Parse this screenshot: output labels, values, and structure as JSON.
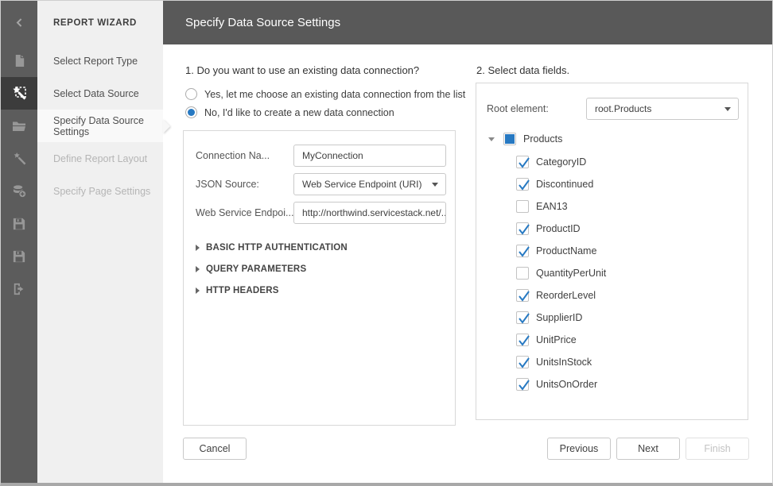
{
  "colors": {
    "accent_blue": "#2779c2",
    "header_bg": "#595959",
    "iconbar_bg": "#5c5c5c",
    "iconbar_active_bg": "#3c3c3c",
    "sidebar_bg": "#f0f0f0"
  },
  "iconbar": {
    "items": [
      {
        "icon": "back-chevron",
        "back": true
      },
      {
        "icon": "new-document"
      },
      {
        "icon": "report-wizard",
        "active": true
      },
      {
        "icon": "open-folder"
      },
      {
        "icon": "design-wizard"
      },
      {
        "icon": "add-datasource"
      },
      {
        "icon": "save"
      },
      {
        "icon": "save-as"
      },
      {
        "icon": "exit"
      }
    ]
  },
  "sidebar": {
    "title": "REPORT WIZARD",
    "items": [
      {
        "label": "Select Report Type",
        "state": "normal"
      },
      {
        "label": "Select Data Source",
        "state": "normal"
      },
      {
        "label": "Specify Data Source Settings",
        "state": "active"
      },
      {
        "label": "Define Report Layout",
        "state": "disabled"
      },
      {
        "label": "Specify Page Settings",
        "state": "disabled"
      }
    ]
  },
  "header": {
    "title": "Specify Data Source Settings"
  },
  "section1": {
    "heading": "1. Do you want to use an existing data connection?",
    "radios": [
      {
        "label": "Yes, let me choose an existing data connection from the list",
        "selected": false
      },
      {
        "label": "No, I'd like to create a new data connection",
        "selected": true
      }
    ],
    "form": {
      "fields": [
        {
          "label": "Connection Na...",
          "value": "MyConnection",
          "type": "text"
        },
        {
          "label": "JSON Source:",
          "value": "Web Service Endpoint (URI)",
          "type": "select"
        },
        {
          "label": "Web Service Endpoi...",
          "value": "http://northwind.servicestack.net/...",
          "type": "text"
        }
      ],
      "sections": [
        {
          "label": "BASIC HTTP AUTHENTICATION"
        },
        {
          "label": "QUERY PARAMETERS"
        },
        {
          "label": "HTTP HEADERS"
        }
      ]
    }
  },
  "section2": {
    "heading": "2. Select data fields.",
    "root_element": {
      "label": "Root element:",
      "value": "root.Products"
    },
    "tree": {
      "root": {
        "label": "Products",
        "state": "indeterminate",
        "expanded": true
      },
      "fields": [
        {
          "label": "CategoryID",
          "checked": true
        },
        {
          "label": "Discontinued",
          "checked": true
        },
        {
          "label": "EAN13",
          "checked": false
        },
        {
          "label": "ProductID",
          "checked": true
        },
        {
          "label": "ProductName",
          "checked": true
        },
        {
          "label": "QuantityPerUnit",
          "checked": false
        },
        {
          "label": "ReorderLevel",
          "checked": true
        },
        {
          "label": "SupplierID",
          "checked": true
        },
        {
          "label": "UnitPrice",
          "checked": true
        },
        {
          "label": "UnitsInStock",
          "checked": true
        },
        {
          "label": "UnitsOnOrder",
          "checked": true
        }
      ]
    }
  },
  "footer": {
    "cancel": "Cancel",
    "previous": "Previous",
    "next": "Next",
    "finish": "Finish",
    "finish_disabled": true
  }
}
